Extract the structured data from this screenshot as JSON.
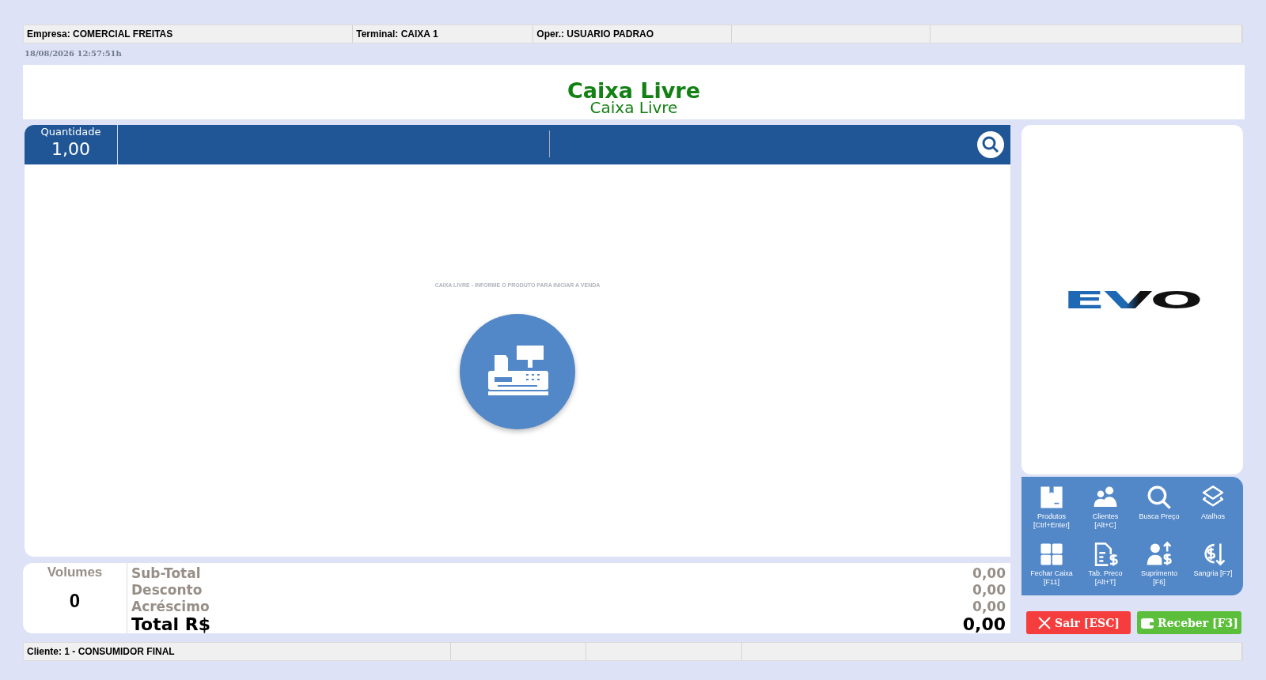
{
  "top_bar": [
    "Empresa: COMERCIAL FREITAS",
    "Terminal: CAIXA 1",
    "Oper.: USUARIO PADRAO"
  ],
  "datetime": "18/08/2026 12:57:51h",
  "title": {
    "main": "Caixa Livre",
    "sub": "Caixa Livre"
  },
  "quantity": {
    "label": "Quantidade",
    "value": "1,00"
  },
  "empty_message": "CAIXA LIVRE - INFORME O PRODUTO PARA INICIAR A VENDA",
  "logo": "EVO",
  "shortcuts": [
    {
      "label": "Produtos",
      "shortcut": "[Ctrl+Enter]"
    },
    {
      "label": "Clientes",
      "shortcut": "[Alt+C]"
    },
    {
      "label": "Busca Preço"
    },
    {
      "label": "Atalhos"
    },
    {
      "label": "Fechar Caixa",
      "shortcut": "[F11]"
    },
    {
      "label": "Tab. Preco",
      "shortcut": "[Alt+T]"
    },
    {
      "label": "Suprimento",
      "shortcut": "[F6]"
    },
    {
      "label": "Sangria  [F7]"
    }
  ],
  "volumes": {
    "label": "Volumes",
    "value": "0"
  },
  "totals": [
    {
      "kind": "sub",
      "label": "Sub-Total",
      "value": "0,00"
    },
    {
      "kind": "sub",
      "label": "Desconto",
      "value": "0,00"
    },
    {
      "kind": "sub",
      "label": "Acréscimo",
      "value": "0,00"
    },
    {
      "kind": "total",
      "label": "Total R$",
      "value": "0,00"
    }
  ],
  "actions": [
    {
      "kind": "exit",
      "label": "Sair [ESC]"
    },
    {
      "kind": "receive",
      "label": "Receber  [F3]"
    }
  ],
  "status_bar": [
    "Cliente: 1 - CONSUMIDOR FINAL"
  ]
}
